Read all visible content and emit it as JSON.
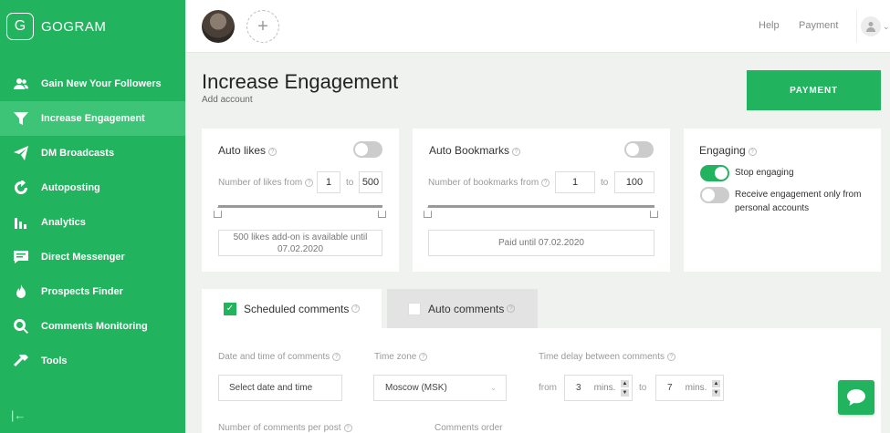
{
  "app": {
    "logo_letter": "G",
    "name": "GOGRAM"
  },
  "sidebar": {
    "items": [
      {
        "label": "Gain New Your Followers",
        "icon": "users-icon"
      },
      {
        "label": "Increase Engagement",
        "icon": "funnel-icon",
        "active": true
      },
      {
        "label": "DM Broadcasts",
        "icon": "paper-plane-icon"
      },
      {
        "label": "Autoposting",
        "icon": "refresh-icon"
      },
      {
        "label": "Analytics",
        "icon": "bar-chart-icon"
      },
      {
        "label": "Direct Messenger",
        "icon": "message-icon"
      },
      {
        "label": "Prospects Finder",
        "icon": "fire-icon"
      },
      {
        "label": "Comments Monitoring",
        "icon": "search-icon"
      },
      {
        "label": "Tools",
        "icon": "hammer-icon"
      }
    ],
    "collapse_glyph": "|←"
  },
  "topbar": {
    "add_glyph": "+",
    "help": "Help",
    "payment": "Payment",
    "chevron": "⌄"
  },
  "header": {
    "title": "Increase Engagement",
    "subtitle": "Add account",
    "pay_button": "PAYMENT"
  },
  "auto_likes": {
    "title": "Auto likes",
    "enabled": false,
    "range_label": "Number of likes from",
    "from": "1",
    "to_label": "to",
    "to": "500",
    "notice": "500 likes add-on is available until 07.02.2020"
  },
  "auto_bookmarks": {
    "title": "Auto Bookmarks",
    "enabled": false,
    "range_label": "Number of bookmarks from",
    "from": "1",
    "to_label": "to",
    "to": "100",
    "notice": "Paid until 07.02.2020"
  },
  "engaging": {
    "title": "Engaging",
    "stop_label": "Stop engaging",
    "stop_enabled": true,
    "personal_label": "Receive engagement only from personal accounts",
    "personal_enabled": false
  },
  "tabs": [
    {
      "label": "Scheduled comments",
      "checked": true,
      "active": true
    },
    {
      "label": "Auto comments",
      "checked": false,
      "active": false
    }
  ],
  "comments_form": {
    "datetime_label": "Date and time of comments",
    "datetime_placeholder": "Select date and time",
    "timezone_label": "Time zone",
    "timezone_value": "Moscow (MSK)",
    "delay_label": "Time delay between comments",
    "from_label": "from",
    "from_value": "3",
    "unit": "mins.",
    "to_label": "to",
    "to_value": "7",
    "per_post_label": "Number of comments per post",
    "order_label": "Comments order"
  },
  "help_glyph": "?",
  "colors": {
    "brand": "#22b35e",
    "active_nav": "#3dc477"
  }
}
